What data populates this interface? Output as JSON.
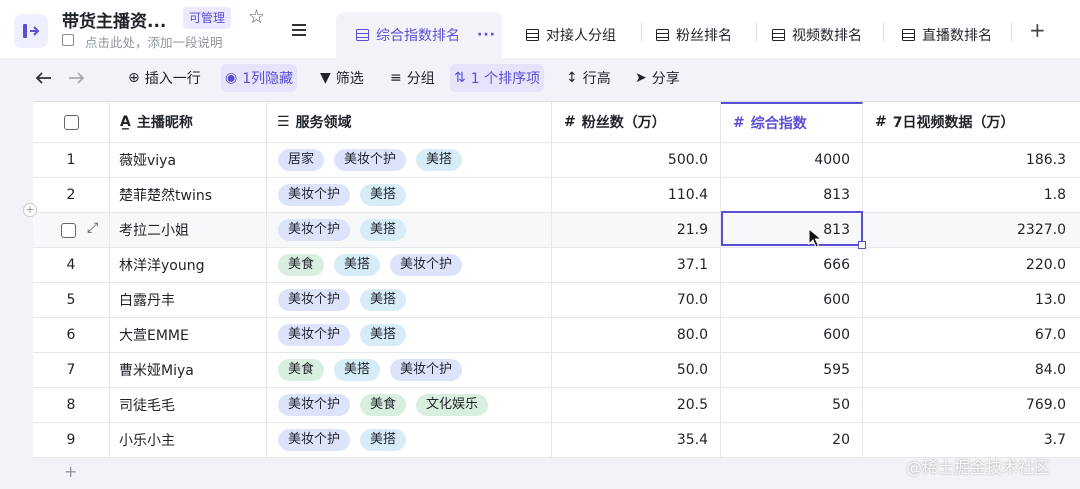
{
  "header": {
    "title": "带货主播资...",
    "permission": "可管理",
    "description_placeholder": "点击此处，添加一段说明"
  },
  "tabs": [
    {
      "label": "综合指数排名",
      "active": true
    },
    {
      "label": "对接人分组"
    },
    {
      "label": "粉丝排名"
    },
    {
      "label": "视频数排名"
    },
    {
      "label": "直播数排名"
    }
  ],
  "toolbar": {
    "insert_row": "插入一行",
    "hidden_cols": "1列隐藏",
    "filter": "筛选",
    "group": "分组",
    "sort": "1 个排序项",
    "row_height": "行高",
    "share": "分享"
  },
  "columns": [
    "主播昵称",
    "服务领域",
    "粉丝数（万）",
    "综合指数",
    "7日视频数据（万）"
  ],
  "rows": [
    {
      "idx": "1",
      "name": "薇娅viya",
      "tags": [
        "居家",
        "美妆个护",
        "美搭"
      ],
      "fans": "500.0",
      "score": "4000",
      "video": "186.3"
    },
    {
      "idx": "2",
      "name": "楚菲楚然twins",
      "tags": [
        "美妆个护",
        "美搭"
      ],
      "fans": "110.4",
      "score": "813",
      "video": "1.8"
    },
    {
      "idx": "3",
      "name": "考拉二小姐",
      "tags": [
        "美妆个护",
        "美搭"
      ],
      "fans": "21.9",
      "score": "813",
      "video": "2327.0"
    },
    {
      "idx": "4",
      "name": "林洋洋young",
      "tags": [
        "美食",
        "美搭",
        "美妆个护"
      ],
      "fans": "37.1",
      "score": "666",
      "video": "220.0"
    },
    {
      "idx": "5",
      "name": "白露丹丰",
      "tags": [
        "美妆个护",
        "美搭"
      ],
      "fans": "70.0",
      "score": "600",
      "video": "13.0"
    },
    {
      "idx": "6",
      "name": "大萱EMME",
      "tags": [
        "美妆个护",
        "美搭"
      ],
      "fans": "80.0",
      "score": "600",
      "video": "67.0"
    },
    {
      "idx": "7",
      "name": "曹米娅Miya",
      "tags": [
        "美食",
        "美搭",
        "美妆个护"
      ],
      "fans": "50.0",
      "score": "595",
      "video": "84.0"
    },
    {
      "idx": "8",
      "name": "司徒毛毛",
      "tags": [
        "美妆个护",
        "美食",
        "文化娱乐"
      ],
      "fans": "20.5",
      "score": "50",
      "video": "769.0"
    },
    {
      "idx": "9",
      "name": "小乐小主",
      "tags": [
        "美妆个护",
        "美搭"
      ],
      "fans": "35.4",
      "score": "20",
      "video": "3.7"
    }
  ],
  "tag_colors": {
    "居家": "blue",
    "美妆个护": "blue",
    "美搭": "cyan",
    "美食": "green",
    "文化娱乐": "green"
  },
  "add_row_symbol": "+",
  "watermark": "@稀土掘金技术社区"
}
